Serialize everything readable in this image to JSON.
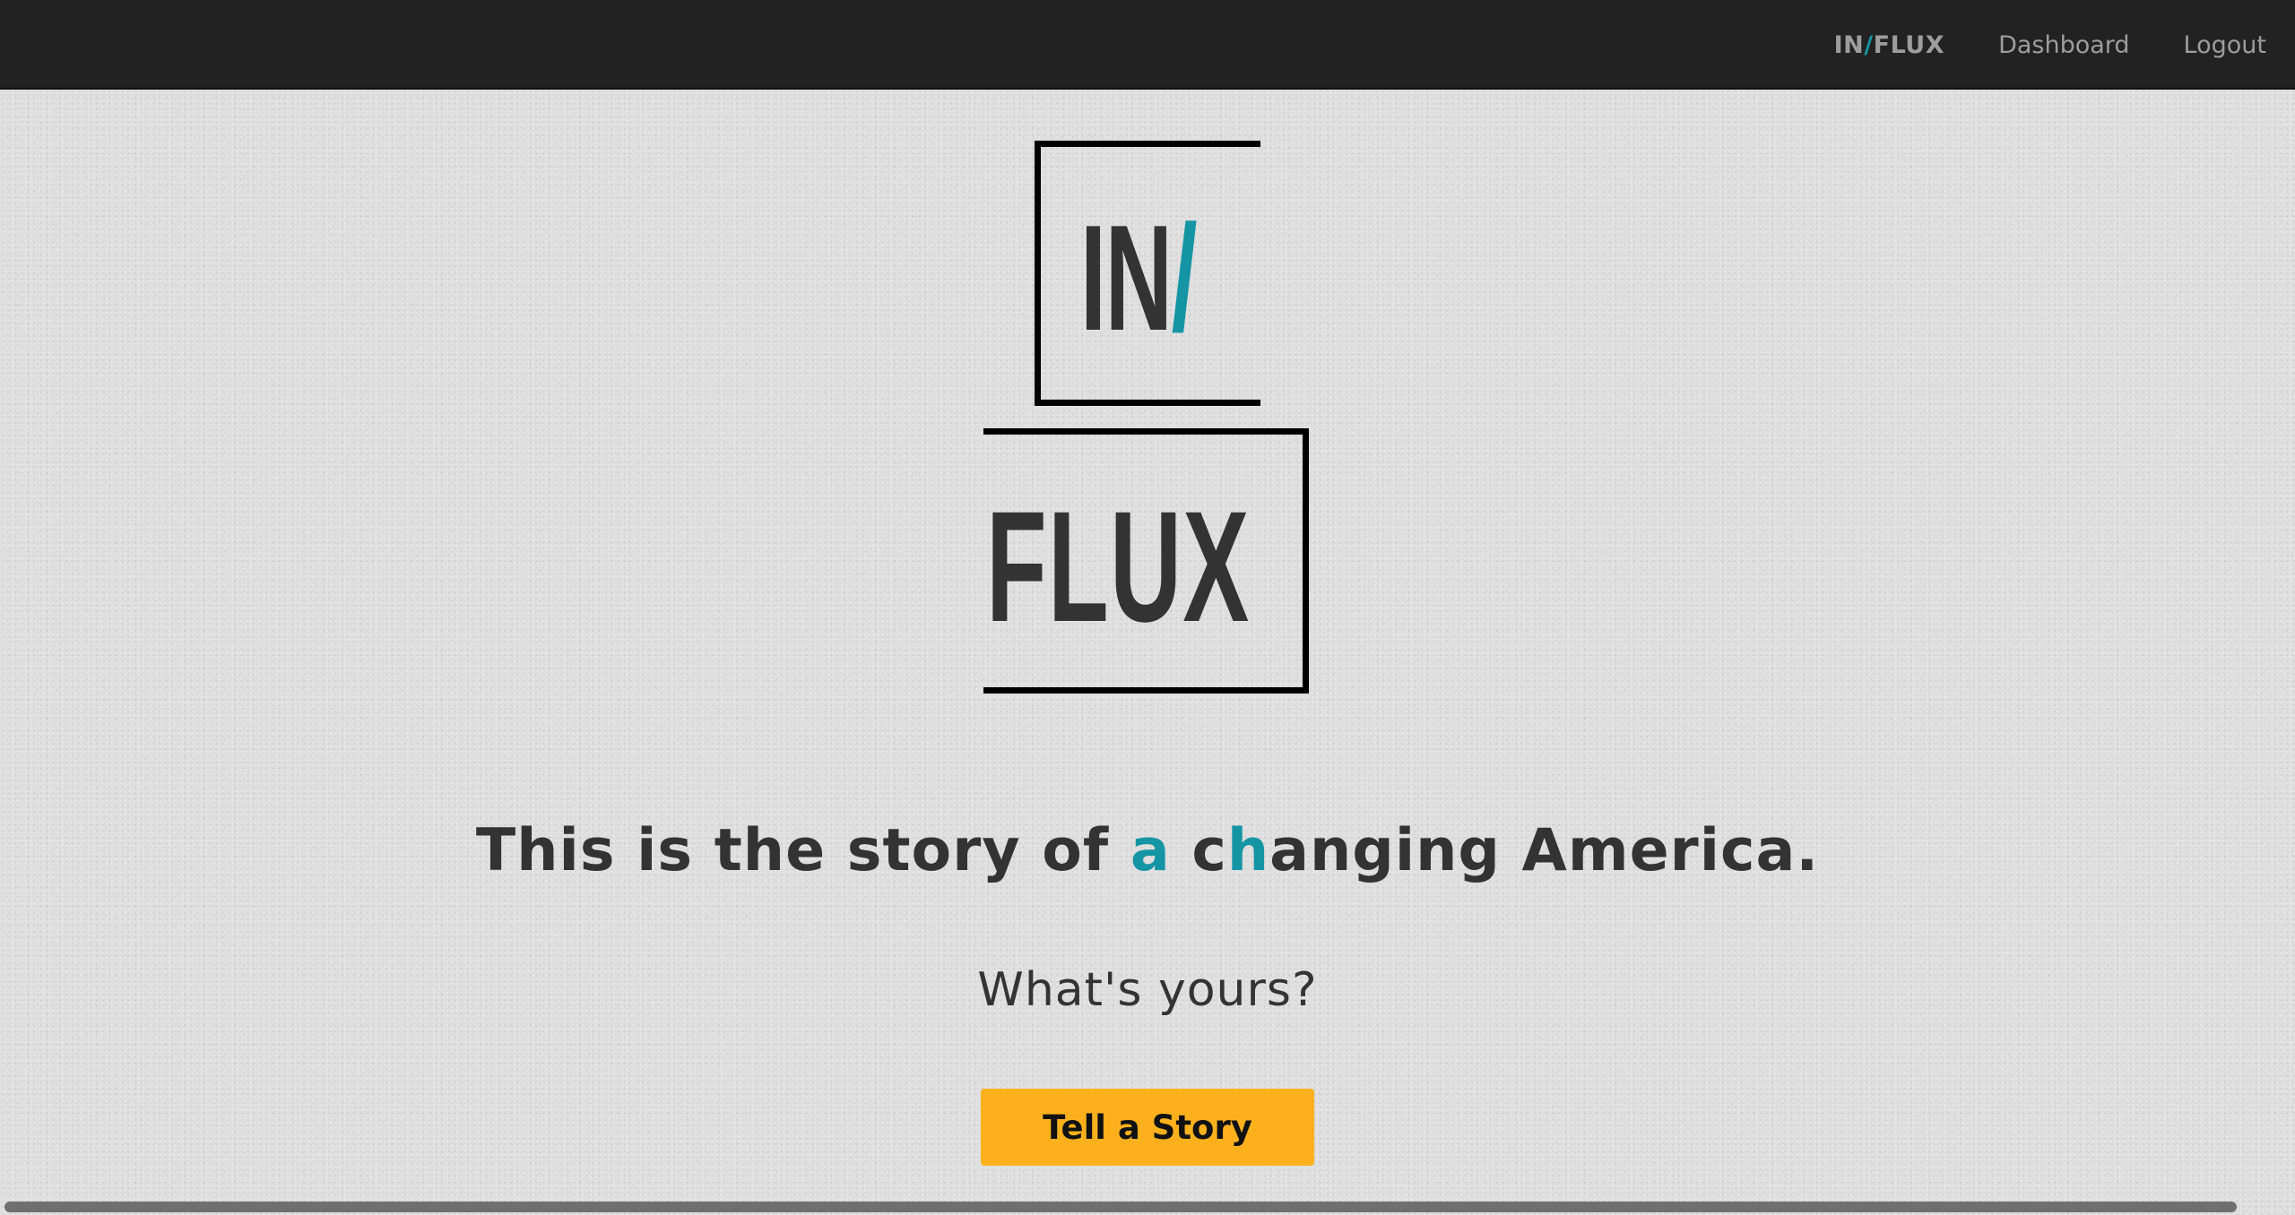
{
  "navbar": {
    "brand_in": "IN",
    "brand_slash": "/",
    "brand_flux": "FLUX",
    "links": [
      {
        "label": "Dashboard"
      },
      {
        "label": "Logout"
      }
    ]
  },
  "logo": {
    "top_word": "IN",
    "top_slash": "/",
    "bottom_word": "FLUX"
  },
  "hero": {
    "tagline_part1": "This is the story of ",
    "tagline_accent1": "a",
    "tagline_part2": " c",
    "tagline_accent2": "h",
    "tagline_part3": "anging America.",
    "subline": "What's yours?",
    "cta_label": "Tell a Story"
  },
  "colors": {
    "accent": "#1595a3",
    "cta": "#fcb11c",
    "navbar_bg": "#222222",
    "page_bg": "#dedede",
    "text": "#333333"
  }
}
